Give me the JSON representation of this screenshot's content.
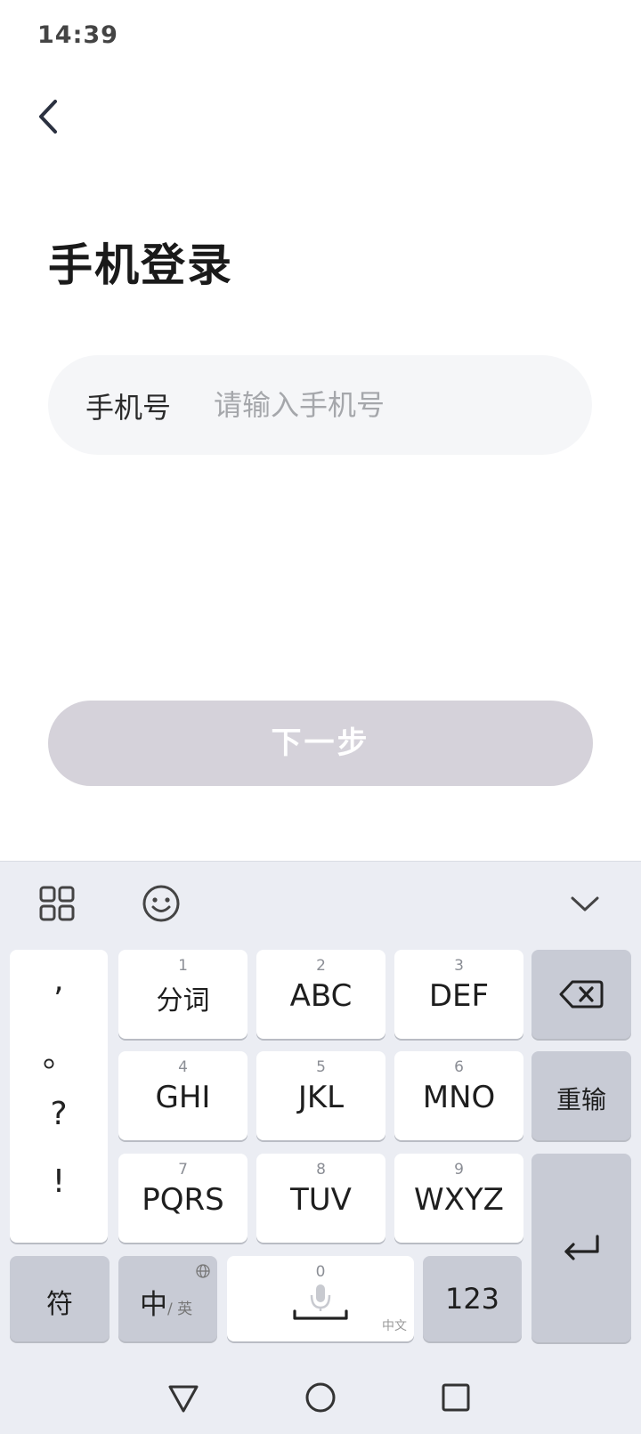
{
  "status": {
    "time": "14:39"
  },
  "header": {
    "back_icon": "chevron-left-icon"
  },
  "page": {
    "title": "手机登录"
  },
  "phone": {
    "label": "手机号",
    "placeholder": "请输入手机号",
    "value": ""
  },
  "next_button": {
    "label": "下一步"
  },
  "keyboard": {
    "toolbar": {
      "grid_icon": "grid-icon",
      "emoji_icon": "emoji-icon",
      "collapse_icon": "chevron-down-icon"
    },
    "punctuation": [
      ",",
      "。",
      "?",
      "!"
    ],
    "keys": {
      "k1": {
        "num": "1",
        "label": "分词"
      },
      "k2": {
        "num": "2",
        "label": "ABC"
      },
      "k3": {
        "num": "3",
        "label": "DEF"
      },
      "k4": {
        "num": "4",
        "label": "GHI"
      },
      "k5": {
        "num": "5",
        "label": "JKL"
      },
      "k6": {
        "num": "6",
        "label": "MNO"
      },
      "k7": {
        "num": "7",
        "label": "PQRS"
      },
      "k8": {
        "num": "8",
        "label": "TUV"
      },
      "k9": {
        "num": "9",
        "label": "WXYZ"
      }
    },
    "backspace_icon": "backspace-icon",
    "reinput_label": "重输",
    "enter_icon": "enter-icon",
    "symbol_label": "符",
    "lang_main": "中",
    "lang_sub": "/ 英",
    "globe_icon": "globe-icon",
    "space": {
      "num": "0",
      "hint": "中文",
      "mic_icon": "mic-icon"
    },
    "numeric_label": "123"
  },
  "navbar": {
    "back_icon": "triangle-back-icon",
    "home_icon": "circle-home-icon",
    "recents_icon": "square-recents-icon"
  }
}
